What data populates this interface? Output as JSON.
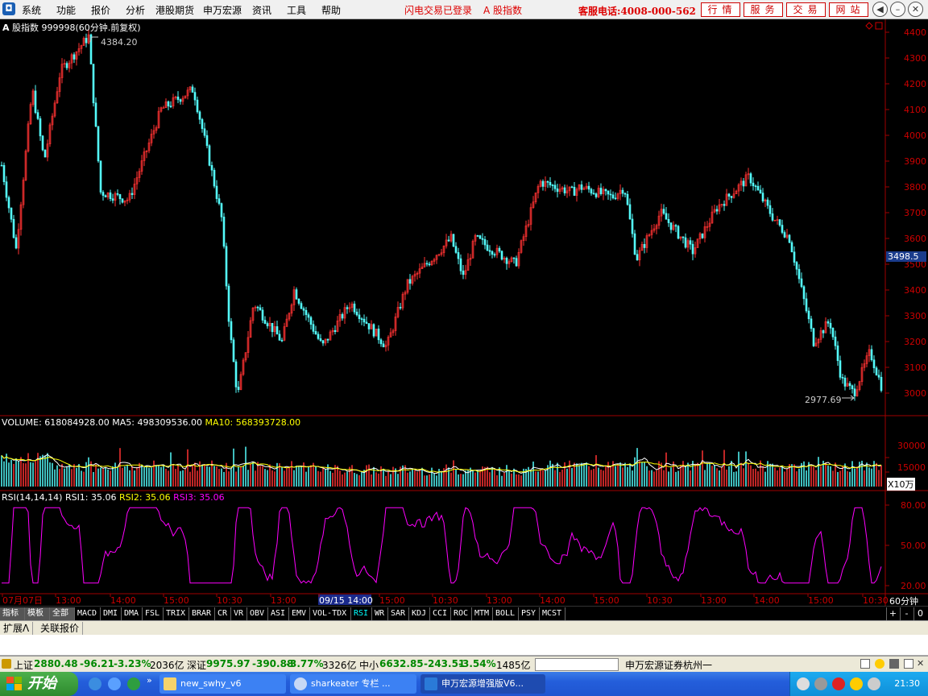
{
  "menubar": {
    "items": [
      "系统",
      "功能",
      "报价",
      "分析",
      "港股期货",
      "申万宏源",
      "资讯",
      "工具",
      "帮助"
    ],
    "flash_status": "闪电交易已登录",
    "index_link": "A 股指数",
    "hotline": "客服电话:4008-000-562",
    "buttons": [
      "行情",
      "服务",
      "交易",
      "网站"
    ]
  },
  "chart": {
    "header": {
      "symbol_icon": "A",
      "title": "股指数 999998(60分钟.前复权)"
    },
    "price_axis_labels": [
      "4400",
      "4300",
      "4200",
      "4100",
      "4000",
      "3900",
      "3800",
      "3700",
      "3600",
      "3500",
      "3400",
      "3300",
      "3200",
      "3100",
      "3000"
    ],
    "current_price_tag": "3498.5",
    "high_label": "4384.20",
    "low_label": "2977.69",
    "volume": {
      "label": "VOLUME:",
      "value": "618084928.00",
      "ma5_label": "MA5:",
      "ma5": "498309536.00",
      "ma10_label": "MA10:",
      "ma10": "568393728.00",
      "axis_labels": [
        "30000",
        "15000"
      ],
      "unit": "X10万"
    },
    "rsi": {
      "label": "RSI(14,14,14)",
      "rsi1_label": "RSI1:",
      "rsi1": "35.06",
      "rsi2_label": "RSI2:",
      "rsi2": "35.06",
      "rsi3_label": "RSI3:",
      "rsi3": "35.06",
      "axis_labels": [
        "80.00",
        "50.00",
        "20.00"
      ]
    },
    "time_labels": [
      "07月07日",
      "13:00",
      "14:00",
      "15:00",
      "10:30",
      "13:00",
      "09/15 14:00",
      "15:00",
      "10:30",
      "13:00",
      "14:00",
      "15:00",
      "10:30",
      "13:00",
      "14:00",
      "15:00",
      "10:30"
    ],
    "period": "60分钟",
    "colors": {
      "up": "#ff3232",
      "down": "#54fcfc",
      "ma5": "#ffffff",
      "ma10": "#ffff00",
      "rsi": "#ff00ff",
      "grid": "#800000"
    }
  },
  "tabs": {
    "mode_labels": [
      "指标",
      "模板",
      "全部"
    ],
    "indicators": [
      "MACD",
      "DMI",
      "DMA",
      "FSL",
      "TRIX",
      "BRAR",
      "CR",
      "VR",
      "OBV",
      "ASI",
      "EMV",
      "VOL-TDX",
      "RSI",
      "WR",
      "SAR",
      "KDJ",
      "CCI",
      "ROC",
      "MTM",
      "BOLL",
      "PSY",
      "MCST"
    ],
    "active": "RSI",
    "controls": [
      "+",
      "-",
      "0"
    ]
  },
  "subtabs": [
    "扩展Λ",
    "关联报价"
  ],
  "statusbar": {
    "sh_label": "上证",
    "sh_value": "2880.48",
    "sh_change": "-96.21",
    "sh_pct": "-3.23%",
    "sh_amount": "2036亿",
    "sz_label": "深证",
    "sz_value": "9975.97",
    "sz_change": "-390.88",
    "sz_pct": "-3.77%",
    "sz_amount": "3326亿",
    "zx_label": "中小",
    "zx_value": "6632.85",
    "zx_change": "-243.51",
    "zx_pct": "-3.54%",
    "zx_amount": "1485亿",
    "broker": "申万宏源证券杭州一"
  },
  "taskbar": {
    "start": "开始",
    "items": [
      "new_swhy_v6",
      "sharkeater 专栏 ...",
      "申万宏源增强版V6..."
    ],
    "clock": "21:30"
  }
}
